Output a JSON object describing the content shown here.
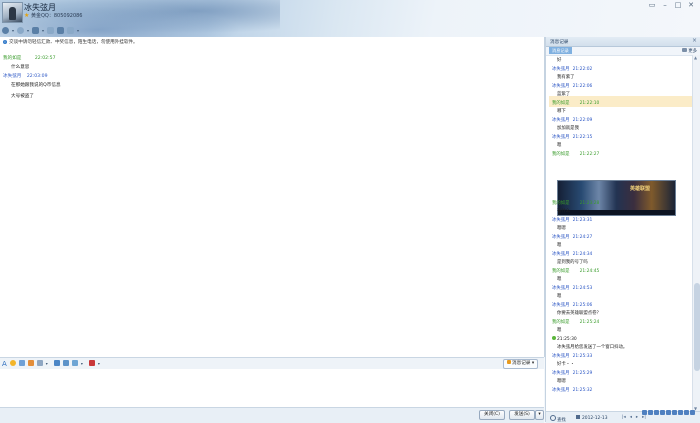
{
  "header": {
    "contact_name": "冰失弦月",
    "status_line": "黄金QQ：805092086"
  },
  "notice": "交谈中请勿轻信汇款、中奖信息，陌生电话，勿使用外挂软件。",
  "chat": [
    {
      "sender": "我的如是",
      "time": "22:02:57",
      "text": "什么意思",
      "side": "self"
    },
    {
      "sender": "冰失弦月",
      "time": "22:03:09",
      "text": "在那她跟我说的Q币信息",
      "side": "other"
    },
    {
      "sender": "",
      "time": "",
      "text": "大号被盗了",
      "side": "other"
    }
  ],
  "input_toolbar": {
    "message_record_label": "消息记录"
  },
  "bottom_bar": {
    "close_label": "关闭(C)",
    "send_label": "发送(S)",
    "send_options_label": "▾"
  },
  "history": {
    "title": "消息记录",
    "tab_label": "消息记录",
    "more_label": "更多",
    "items": [
      {
        "kind": "text",
        "text": "好"
      },
      {
        "kind": "name",
        "side": "other",
        "sender": "冰失弦月",
        "time": "21:22:02"
      },
      {
        "kind": "text",
        "text": "我有紫了"
      },
      {
        "kind": "name",
        "side": "other",
        "sender": "冰失弦月",
        "time": "21:22:06"
      },
      {
        "kind": "text",
        "text": "蓝紫了"
      },
      {
        "kind": "name",
        "side": "self",
        "sender": "我的如是",
        "time": "21:22:10"
      },
      {
        "kind": "text",
        "text": "哪下"
      },
      {
        "kind": "name",
        "side": "other",
        "sender": "冰失弦月",
        "time": "21:22:09"
      },
      {
        "kind": "text",
        "text": "加加就是我"
      },
      {
        "kind": "name",
        "side": "other",
        "sender": "冰失弦月",
        "time": "21:22:15"
      },
      {
        "kind": "text",
        "text": "嗯"
      },
      {
        "kind": "name",
        "side": "self",
        "sender": "我的如是",
        "time": "21:22:27"
      },
      {
        "kind": "name",
        "side": "self",
        "sender": "我的如是",
        "time": "21:23:28"
      },
      {
        "kind": "text",
        "text": "有什么"
      },
      {
        "kind": "name",
        "side": "other",
        "sender": "冰失弦月",
        "time": "21:23:31"
      },
      {
        "kind": "text",
        "text": "嗯嗯"
      },
      {
        "kind": "name",
        "side": "other",
        "sender": "冰失弦月",
        "time": "21:24:27"
      },
      {
        "kind": "text",
        "text": "嗯"
      },
      {
        "kind": "name",
        "side": "other",
        "sender": "冰失弦月",
        "time": "21:24:34"
      },
      {
        "kind": "text",
        "text": "是到我的号了吗"
      },
      {
        "kind": "name",
        "side": "self",
        "sender": "我的如是",
        "time": "21:24:45"
      },
      {
        "kind": "text",
        "text": "嗯"
      },
      {
        "kind": "name",
        "side": "other",
        "sender": "冰失弦月",
        "time": "21:24:53"
      },
      {
        "kind": "text",
        "text": "嗯"
      },
      {
        "kind": "name",
        "side": "other",
        "sender": "冰失弦月",
        "time": "21:25:06"
      },
      {
        "kind": "text",
        "text": "你要去英雄联盟点卷？"
      },
      {
        "kind": "name",
        "side": "self",
        "sender": "我的如是",
        "time": "21:25:24"
      },
      {
        "kind": "text",
        "text": "嗯"
      },
      {
        "kind": "name",
        "side": "system",
        "sender": "",
        "time": "21:25:30"
      },
      {
        "kind": "text",
        "text": "冰失弦月给您发送了一个窗口抖动。"
      },
      {
        "kind": "name",
        "side": "other",
        "sender": "冰失弦月",
        "time": "21:25:33"
      },
      {
        "kind": "text",
        "text": "好卡・・"
      },
      {
        "kind": "name",
        "side": "other",
        "sender": "冰失弦月",
        "time": "21:25:29"
      },
      {
        "kind": "text",
        "text": "嗯嗯"
      },
      {
        "kind": "name",
        "side": "other",
        "sender": "冰失弦月",
        "time": "21:25:32"
      }
    ],
    "image_caption": "英雄联盟",
    "search_label": "查找",
    "date": "2012-12-13"
  },
  "colors": {
    "self_name": "#3a9c2c",
    "other_name": "#2a55c4",
    "highlight": "#fbecc8"
  }
}
